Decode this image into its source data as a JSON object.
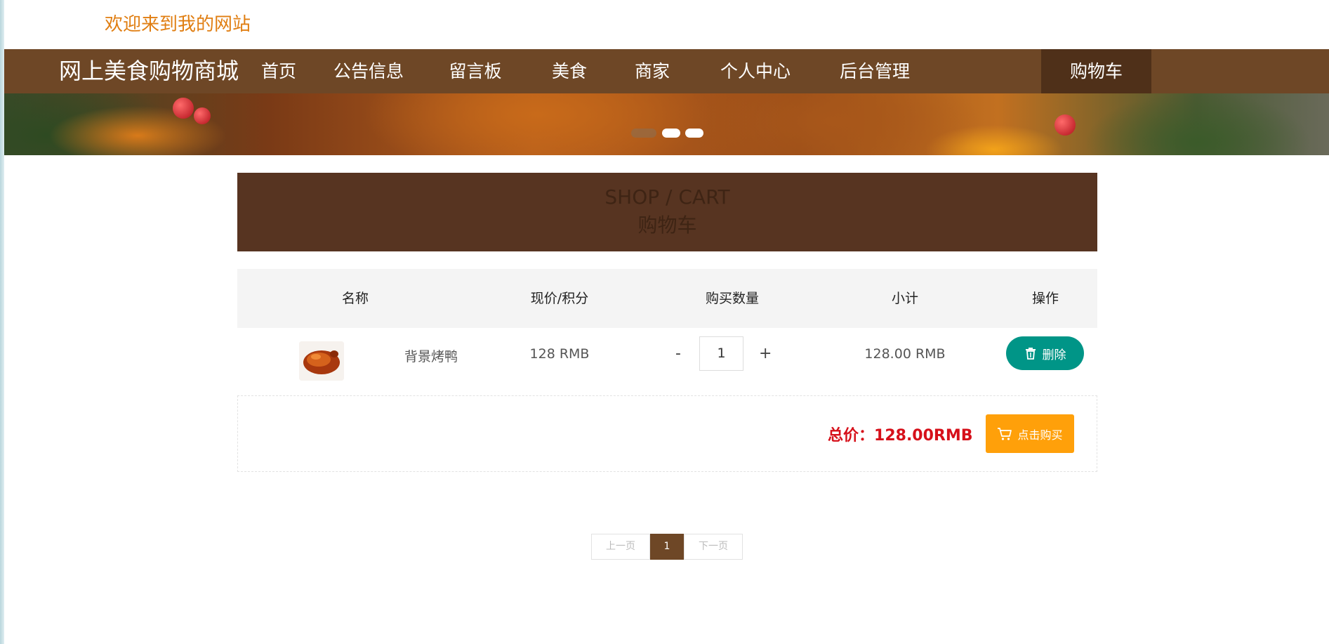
{
  "header": {
    "welcome": "欢迎来到我的网站"
  },
  "nav": {
    "brand": "网上美食购物商城",
    "items": [
      {
        "label": "首页"
      },
      {
        "label": "公告信息"
      },
      {
        "label": "留言板"
      },
      {
        "label": "美食"
      },
      {
        "label": "商家"
      },
      {
        "label": "个人中心"
      },
      {
        "label": "后台管理"
      },
      {
        "label": "购物车",
        "active": true
      }
    ]
  },
  "banner": {
    "slides": 3,
    "active_slide": 1
  },
  "cart": {
    "title_en": "SHOP / CART",
    "title_cn": "购物车",
    "columns": [
      "名称",
      "现价/积分",
      "购买数量",
      "小计",
      "操作"
    ],
    "items": [
      {
        "image_icon": "roast-duck-image",
        "name": "背景烤鸭",
        "price": "128 RMB",
        "minus": "-",
        "quantity": "1",
        "plus": "+",
        "subtotal": "128.00 RMB",
        "delete_label": "删除"
      }
    ],
    "total_label": "总价：",
    "total_value": "128.00RMB",
    "buy_label": "点击购买"
  },
  "pagination": {
    "prev": "上一页",
    "current": "1",
    "next": "下一页"
  },
  "colors": {
    "nav_bg": "#6e4726",
    "nav_active": "#4f3019",
    "accent_orange": "#e07e12",
    "delete_green": "#009587",
    "buy_orange": "#ffa00a",
    "total_red": "#d6101a"
  }
}
